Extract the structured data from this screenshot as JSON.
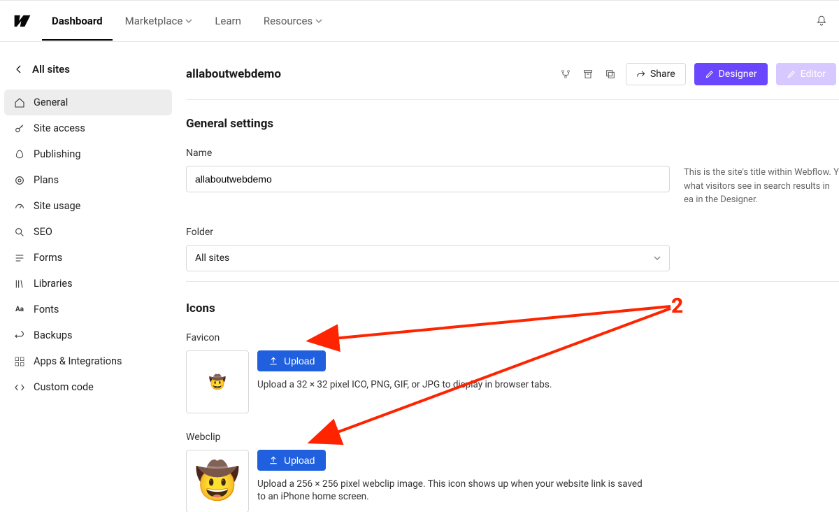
{
  "topnav": {
    "items": [
      {
        "label": "Dashboard",
        "active": true
      },
      {
        "label": "Marketplace",
        "dropdown": true
      },
      {
        "label": "Learn"
      },
      {
        "label": "Resources",
        "dropdown": true
      }
    ]
  },
  "sidebar": {
    "back_label": "All sites",
    "items": [
      {
        "label": "General",
        "icon": "home"
      },
      {
        "label": "Site access",
        "icon": "key"
      },
      {
        "label": "Publishing",
        "icon": "rocket"
      },
      {
        "label": "Plans",
        "icon": "target"
      },
      {
        "label": "Site usage",
        "icon": "gauge"
      },
      {
        "label": "SEO",
        "icon": "search"
      },
      {
        "label": "Forms",
        "icon": "lines"
      },
      {
        "label": "Libraries",
        "icon": "books"
      },
      {
        "label": "Fonts",
        "icon": "font"
      },
      {
        "label": "Backups",
        "icon": "undo"
      },
      {
        "label": "Apps & Integrations",
        "icon": "grid"
      },
      {
        "label": "Custom code",
        "icon": "code"
      }
    ],
    "active_index": 0
  },
  "header": {
    "title": "allaboutwebdemo",
    "share": "Share",
    "designer": "Designer",
    "editor": "Editor"
  },
  "general": {
    "section_title": "General settings",
    "name_label": "Name",
    "name_value": "allaboutwebdemo",
    "name_help": "This is the site's title within Webflow. Y what visitors see in search results in ea in the Designer.",
    "folder_label": "Folder",
    "folder_value": "All sites"
  },
  "icons": {
    "section_title": "Icons",
    "favicon_label": "Favicon",
    "favicon_help": "Upload a 32 × 32 pixel ICO, PNG, GIF, or JPG to display in browser tabs.",
    "webclip_label": "Webclip",
    "webclip_help": "Upload a 256 × 256 pixel webclip image. This icon shows up when your website link is saved to an iPhone home screen.",
    "upload_label": "Upload",
    "preview_emoji": "🤠"
  },
  "annotation": {
    "num": "2"
  }
}
